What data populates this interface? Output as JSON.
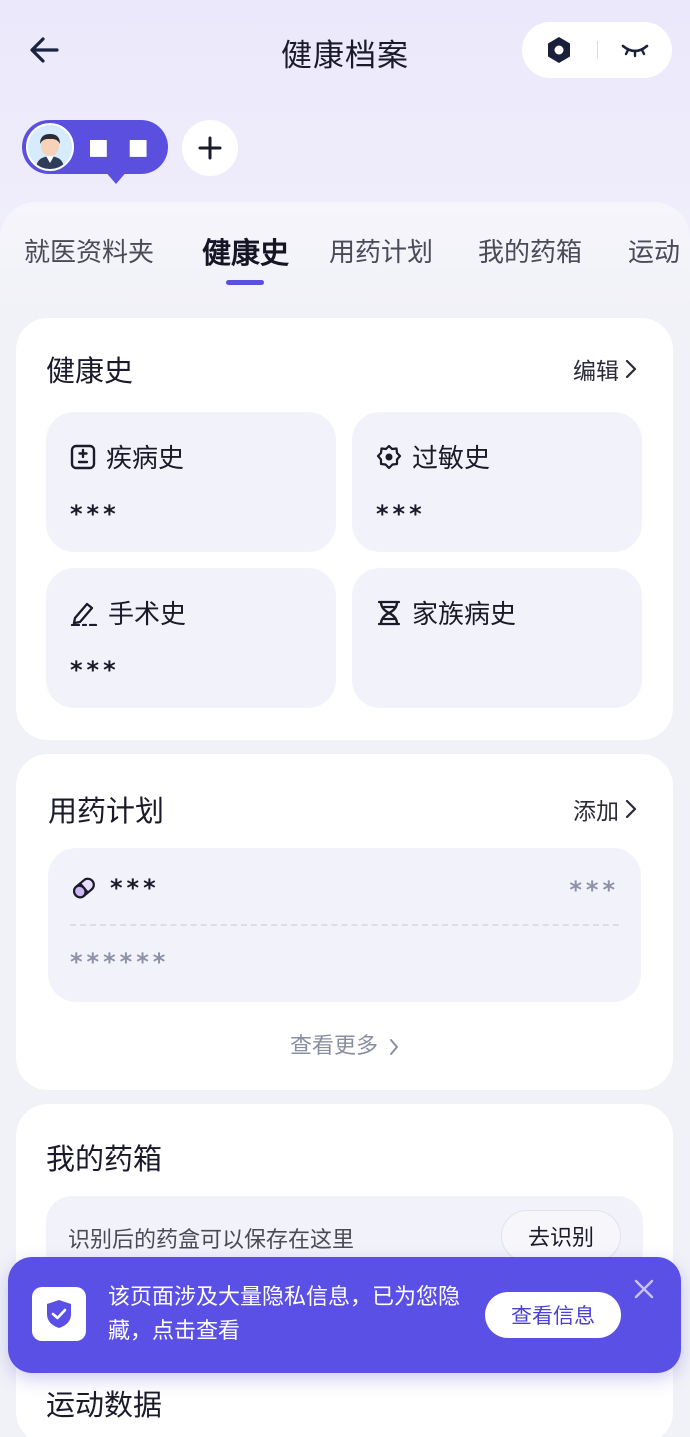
{
  "header": {
    "title": "健康档案",
    "back_icon": "arrow-left-icon",
    "pill_icons": [
      "privacy-eye-icon",
      "eye-closed-icon"
    ]
  },
  "profile": {
    "name": "■ ■",
    "add_icon": "plus-icon"
  },
  "tabs": [
    {
      "label": "就医资料夹",
      "active": false
    },
    {
      "label": "健康史",
      "active": true
    },
    {
      "label": "用药计划",
      "active": false
    },
    {
      "label": "我的药箱",
      "active": false
    },
    {
      "label": "运动",
      "active": false
    }
  ],
  "health_history": {
    "title": "健康史",
    "action": "编辑",
    "tiles": [
      {
        "label": "疾病史",
        "value": "***",
        "icon": "plus-minus-icon"
      },
      {
        "label": "过敏史",
        "value": "***",
        "icon": "gear-icon"
      },
      {
        "label": "手术史",
        "value": "***",
        "icon": "pen-icon"
      },
      {
        "label": "家族病史",
        "value": "",
        "icon": "dna-icon"
      }
    ]
  },
  "medication_plan": {
    "title": "用药计划",
    "action": "添加",
    "item": {
      "name": "***",
      "time": "***",
      "dose": "******",
      "icon": "pill-icon"
    },
    "view_more": "查看更多"
  },
  "medicine_box": {
    "title": "我的药箱",
    "hint": "识别后的药盒可以保存在这里",
    "button": "去识别"
  },
  "sport": {
    "title": "运动数据"
  },
  "privacy_banner": {
    "text": "该页面涉及大量隐私信息，已为您隐藏，点击查看",
    "button": "查看信息",
    "icon": "shield-check-icon",
    "close_icon": "close-icon"
  },
  "colors": {
    "accent": "#5b4fe0",
    "banner": "#5a50e6",
    "background": "#f1f2f8",
    "tile": "#f2f3fa"
  }
}
